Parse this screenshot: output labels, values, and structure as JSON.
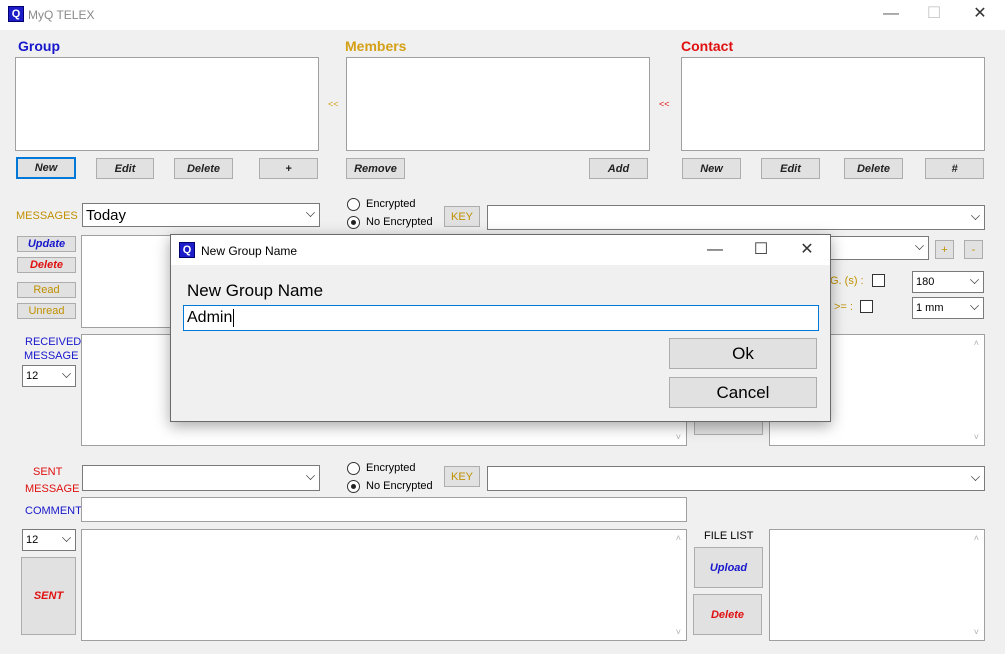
{
  "window": {
    "title": "MyQ TELEX",
    "minimize_glyph": "—",
    "maximize_glyph": "☐",
    "close_glyph": "✕"
  },
  "sections": {
    "group": "Group",
    "members": "Members",
    "contact": "Contact"
  },
  "arrows": {
    "members_to_group": "<<",
    "contact_to_members": "<<"
  },
  "group_buttons": {
    "new": "New",
    "edit": "Edit",
    "delete": "Delete",
    "plus": "+"
  },
  "members_buttons": {
    "remove": "Remove",
    "add": "Add"
  },
  "contact_buttons": {
    "new": "New",
    "edit": "Edit",
    "delete": "Delete",
    "hash": "#"
  },
  "messages": {
    "label": "MESSAGES",
    "filter_value": "Today",
    "encrypted_label": "Encrypted",
    "no_encrypted_label": "No Encrypted",
    "selected_encryption": "No Encrypted",
    "key_button": "KEY",
    "update_button": "Update",
    "delete_button": "Delete",
    "read_button": "Read",
    "unread_button": "Unread",
    "plus_button": "+",
    "minus_button": "-",
    "timer_label": "G. (s) :",
    "timer_value": "180",
    "size_label": ">= :",
    "size_value": "1 mm"
  },
  "received": {
    "label_line1": "RECEIVED",
    "label_line2": "MESSAGE",
    "font_size": "12"
  },
  "sent": {
    "label_line1": "SENT",
    "label_line2": "MESSAGE",
    "encrypted_label": "Encrypted",
    "no_encrypted_label": "No Encrypted",
    "selected_encryption": "No Encrypted",
    "key_button": "KEY",
    "comment_label": "COMMENT",
    "font_size": "12",
    "sent_button": "SENT",
    "file_list_label": "FILE LIST",
    "upload_button": "Upload",
    "delete_button": "Delete"
  },
  "dialog": {
    "title": "New Group Name",
    "prompt": "New Group Name",
    "input_value": "Admin",
    "ok_button": "Ok",
    "cancel_button": "Cancel",
    "minimize_glyph": "—",
    "maximize_glyph": "☐",
    "close_glyph": "✕"
  },
  "colors": {
    "blue": "#1717cc",
    "gold": "#d4a017",
    "red": "#e01010",
    "focus": "#0078d7"
  }
}
